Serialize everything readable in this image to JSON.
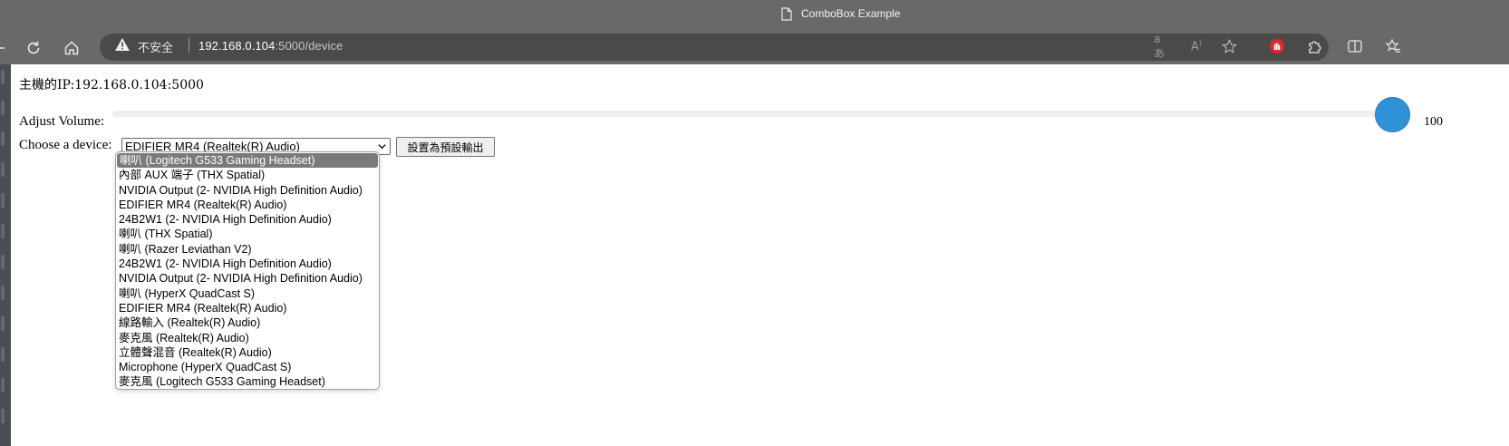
{
  "browser": {
    "tab_title": "ComboBox Example",
    "security_label": "不安全",
    "url_host": "192.168.0.104",
    "url_rest": ":5000/device"
  },
  "page": {
    "host_ip": "主機的IP:192.168.0.104:5000",
    "volume_label": "Adjust Volume:",
    "volume_value": "100",
    "volume_level": 1.0,
    "device_label": "Choose a device:",
    "selected_device": "EDIFIER MR4 (Realtek(R) Audio)",
    "default_button": "設置為預設輸出",
    "device_options": [
      "喇叭 (Logitech G533 Gaming Headset)",
      "內部 AUX 端子 (THX Spatial)",
      "NVIDIA Output (2- NVIDIA High Definition Audio)",
      "EDIFIER MR4 (Realtek(R) Audio)",
      "24B2W1 (2- NVIDIA High Definition Audio)",
      "喇叭 (THX Spatial)",
      "喇叭 (Razer Leviathan V2)",
      "24B2W1 (2- NVIDIA High Definition Audio)",
      "NVIDIA Output (2- NVIDIA High Definition Audio)",
      "喇叭 (HyperX QuadCast S)",
      "EDIFIER MR4 (Realtek(R) Audio)",
      "線路輸入 (Realtek(R) Audio)",
      "麥克風 (Realtek(R) Audio)",
      "立體聲混音 (Realtek(R) Audio)",
      "Microphone (HyperX QuadCast S)",
      "麥克風 (Logitech G533 Gaming Headset)"
    ],
    "highlighted_option": 0
  },
  "colors": {
    "slider_thumb": "#3191d6",
    "highlight": "#7a7a7a",
    "browser_chrome": "#6b6967"
  },
  "icons": [
    "page-icon",
    "back-icon",
    "refresh-icon",
    "home-icon",
    "warning-icon",
    "read-aloud-icon",
    "text-size-icon",
    "favorite-icon",
    "extension-stop-icon",
    "extensions-icon",
    "split-screen-icon",
    "favorites-icon"
  ]
}
